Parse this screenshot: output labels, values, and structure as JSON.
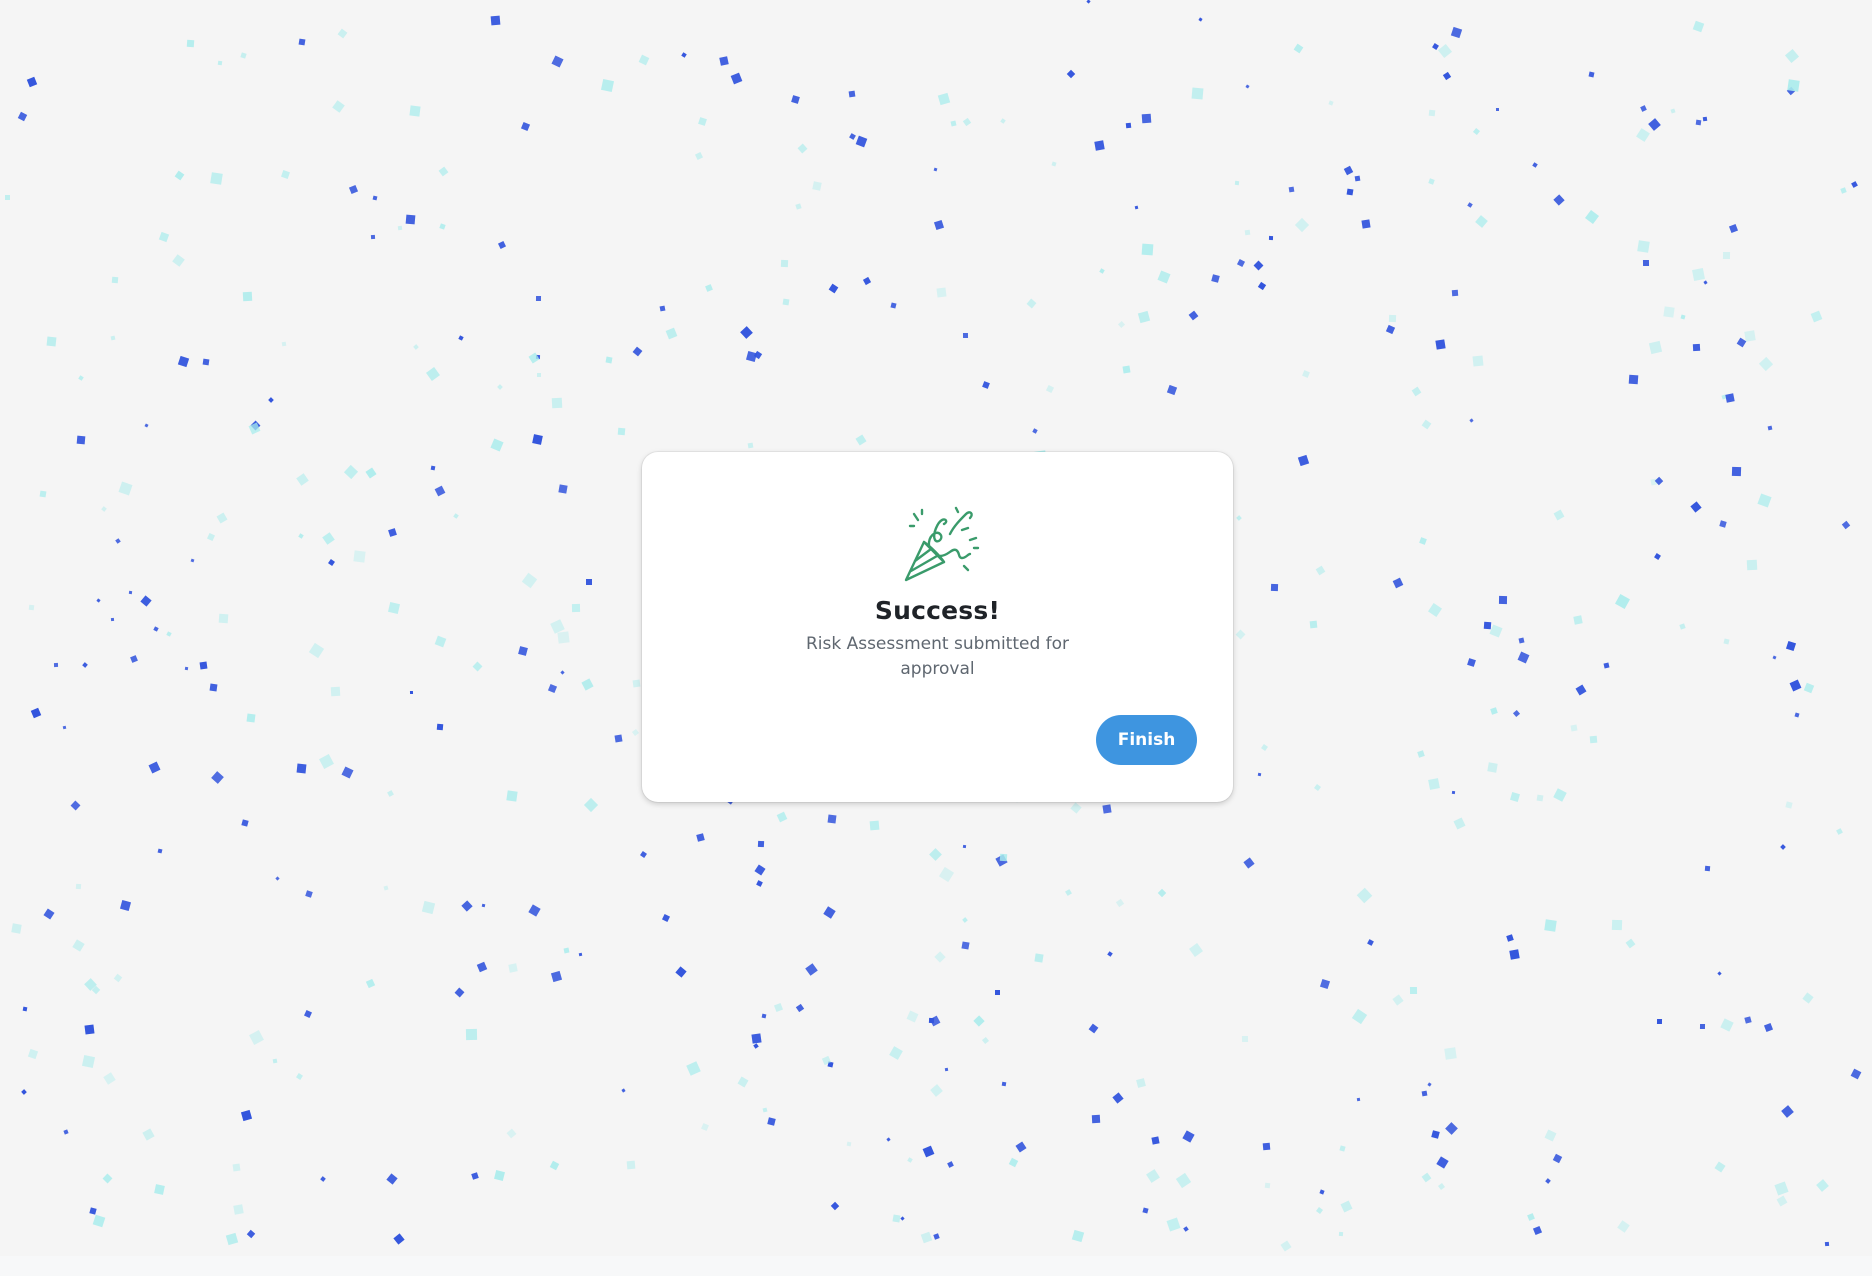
{
  "dialog": {
    "title": "Success!",
    "message": "Risk Assessment submitted for approval",
    "finish_label": "Finish",
    "icon": "party-popper-icon",
    "icon_color": "#3a9b6b",
    "button_color": "#3e95e0"
  },
  "confetti_colors": {
    "dark": "#3355dd",
    "light": "#a8ecec"
  }
}
